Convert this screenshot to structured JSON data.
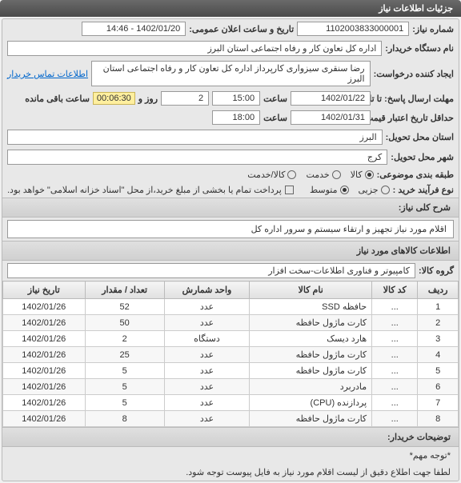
{
  "titlebar": "جزئیات اطلاعات نیاز",
  "fields": {
    "need_no_label": "شماره نیاز:",
    "need_no": "1102003833000001",
    "announce_label": "تاریخ و ساعت اعلان عمومی:",
    "announce": "1402/01/20 - 14:46",
    "buyer_label": "نام دستگاه خریدار:",
    "buyer": "اداره کل تعاون کار و رفاه اجتماعی استان البرز",
    "creator_label": "ایجاد کننده درخواست:",
    "creator": "رضا سنقری سیزواری کارپرداز اداره کل تعاون کار و رفاه اجتماعی استان البرز",
    "contact_link": "اطلاعات تماس خریدار",
    "deadline_label": "مهلت ارسال پاسخ: تا تاریخ:",
    "deadline_date": "1402/01/22",
    "hour_label": "ساعت",
    "deadline_hour": "15:00",
    "day_and_label": "روز و",
    "days_left": "2",
    "timer": "00:06:30",
    "remaining_label": "ساعت باقی مانده",
    "validity_label": "حداقل تاریخ اعتبار قیمت: تا تاریخ:",
    "validity_date": "1402/01/31",
    "validity_hour": "18:00",
    "province_label": "استان محل تحویل:",
    "province": "البرز",
    "city_label": "شهر محل تحویل:",
    "city": "کرج",
    "category_label": "طبقه بندی موضوعی:",
    "process_label": "نوع فرآیند خرید :",
    "payment_note": "پرداخت تمام یا بخشی از مبلغ خرید،از محل \"اسناد خزانه اسلامی\" خواهد بود."
  },
  "radios": {
    "cat_goods": "کالا",
    "cat_service": "خدمت",
    "cat_both": "کالا/خدمت",
    "proc_small": "جزیی",
    "proc_medium": "متوسط"
  },
  "desc": {
    "title": "شرح کلی نیاز:",
    "text": "اقلام مورد نیاز تجهیز و ارتقاء سیستم و سرور اداره کل"
  },
  "items": {
    "title": "اطلاعات کالاهای مورد نیاز",
    "group_label": "گروه کالا:",
    "group": "کامپیوتر و فناوری اطلاعات-سخت افزار",
    "headers": {
      "row": "ردیف",
      "code": "کد کالا",
      "name": "نام کالا",
      "unit": "واحد شمارش",
      "qty": "تعداد / مقدار",
      "date": "تاریخ نیاز"
    },
    "rows": [
      {
        "n": "1",
        "code": "...",
        "name": "حافظه SSD",
        "unit": "عدد",
        "qty": "52",
        "date": "1402/01/26"
      },
      {
        "n": "2",
        "code": "...",
        "name": "کارت ماژول حافظه",
        "unit": "عدد",
        "qty": "50",
        "date": "1402/01/26"
      },
      {
        "n": "3",
        "code": "...",
        "name": "هارد دیسک",
        "unit": "دستگاه",
        "qty": "2",
        "date": "1402/01/26"
      },
      {
        "n": "4",
        "code": "...",
        "name": "کارت ماژول حافظه",
        "unit": "عدد",
        "qty": "25",
        "date": "1402/01/26"
      },
      {
        "n": "5",
        "code": "...",
        "name": "کارت ماژول حافظه",
        "unit": "عدد",
        "qty": "5",
        "date": "1402/01/26"
      },
      {
        "n": "6",
        "code": "...",
        "name": "مادربرد",
        "unit": "عدد",
        "qty": "5",
        "date": "1402/01/26"
      },
      {
        "n": "7",
        "code": "...",
        "name": "پردازنده (CPU)",
        "unit": "عدد",
        "qty": "5",
        "date": "1402/01/26"
      },
      {
        "n": "8",
        "code": "...",
        "name": "کارت ماژول حافظه",
        "unit": "عدد",
        "qty": "8",
        "date": "1402/01/26"
      }
    ]
  },
  "buyer_notes": {
    "title": "توضیحات خریدار:",
    "note_title": "*توجه مهم*",
    "note_text": "لطفا جهت اطلاع دقیق از لیست اقلام مورد نیاز به فایل پیوست توجه شود."
  }
}
